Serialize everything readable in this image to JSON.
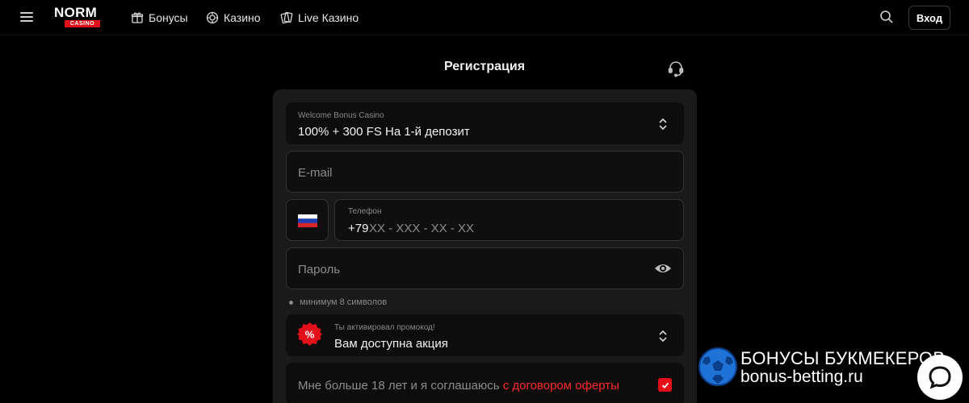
{
  "header": {
    "logo_top": "NORM",
    "logo_bottom": "CASINO",
    "nav": [
      {
        "label": "Бонусы",
        "icon": "gift-icon"
      },
      {
        "label": "Казино",
        "icon": "chip-icon"
      },
      {
        "label": "Live Казино",
        "icon": "cards-icon"
      }
    ],
    "login_label": "Вход"
  },
  "form": {
    "title": "Регистрация",
    "bonus_select": {
      "label": "Welcome Bonus Casino",
      "value": "100% + 300 FS На 1-й депозит"
    },
    "email": {
      "placeholder": "E-mail"
    },
    "phone": {
      "label": "Телефон",
      "prefix": "+79",
      "mask": "XX - XXX - XX - XX",
      "country": "RU"
    },
    "password": {
      "placeholder": "Пароль",
      "hint": "минимум 8 символов"
    },
    "promo": {
      "label": "Ты активировал промокод!",
      "value": "Вам доступна акция",
      "badge": "%"
    },
    "terms": {
      "text": "Мне больше 18 лет и я соглашаюсь",
      "link": "с договором оферты",
      "checked": true
    }
  },
  "watermark": {
    "line1": "БОНУСЫ БУКМЕКЕРОВ",
    "line2": "bonus-betting.ru"
  },
  "colors": {
    "accent": "#e3101b",
    "background": "#000000",
    "panel": "#1a1a1a"
  }
}
